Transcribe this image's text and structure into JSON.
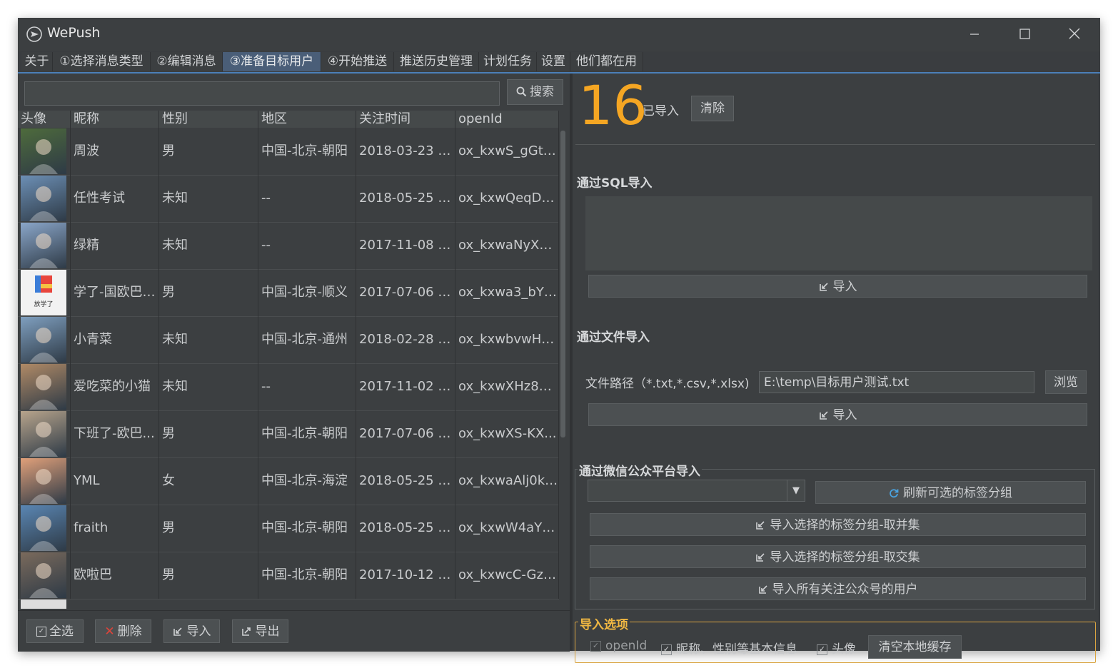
{
  "window": {
    "title": "WePush"
  },
  "tabs": [
    {
      "label": "关于"
    },
    {
      "label": "①选择消息类型"
    },
    {
      "label": "②编辑消息"
    },
    {
      "label": "③准备目标用户"
    },
    {
      "label": "④开始推送"
    },
    {
      "label": "推送历史管理"
    },
    {
      "label": "计划任务"
    },
    {
      "label": "设置"
    },
    {
      "label": "他们都在用"
    }
  ],
  "active_tab": "③准备目标用户",
  "search": {
    "value": "",
    "button_label": "搜索"
  },
  "table": {
    "headers": [
      "头像",
      "昵称",
      "性别",
      "地区",
      "关注时间",
      "openId"
    ],
    "rows": [
      {
        "nickname": "周波",
        "gender": "男",
        "region": "中国-北京-朝阳",
        "time": "2018-03-23 1...",
        "openid": "ox_kxwS_gGt6..."
      },
      {
        "nickname": "任性考试",
        "gender": "未知",
        "region": "--",
        "time": "2018-05-25 1...",
        "openid": "ox_kxwQeqDz..."
      },
      {
        "nickname": "绿精",
        "gender": "未知",
        "region": "--",
        "time": "2017-11-08 1...",
        "openid": "ox_kxwaNyXg..."
      },
      {
        "nickname": "学了-国欧巴-...",
        "gender": "男",
        "region": "中国-北京-顺义",
        "time": "2017-07-06 1...",
        "openid": "ox_kxwa3_bY5..."
      },
      {
        "nickname": "小青菜",
        "gender": "未知",
        "region": "中国-北京-通州",
        "time": "2018-02-28 1...",
        "openid": "ox_kxwbvwHk..."
      },
      {
        "nickname": "爱吃菜的小猫",
        "gender": "未知",
        "region": "--",
        "time": "2017-11-02 1...",
        "openid": "ox_kxwXHz88..."
      },
      {
        "nickname": "下班了-欧巴...",
        "gender": "男",
        "region": "中国-北京-朝阳",
        "time": "2017-07-06 1...",
        "openid": "ox_kxwXS-KX..."
      },
      {
        "nickname": "YML",
        "gender": "女",
        "region": "中国-北京-海淀",
        "time": "2018-05-25 1...",
        "openid": "ox_kxwaAlj0kl..."
      },
      {
        "nickname": "fraith",
        "gender": "男",
        "region": "中国-北京-朝阳",
        "time": "2018-05-25 1...",
        "openid": "ox_kxwW4aYp..."
      },
      {
        "nickname": "欧啦巴",
        "gender": "男",
        "region": "中国-北京-朝阳",
        "time": "2017-10-12 1...",
        "openid": "ox_kxwcC-GzC..."
      }
    ],
    "avatar_colors": [
      "#4e6b3c",
      "#6c8fb5",
      "#8aa6c9",
      "#f2f2f2",
      "#7f9fbf",
      "#b08a66",
      "#b7a48c",
      "#e0a07a",
      "#5a86b3",
      "#7a6a5c"
    ]
  },
  "avatar_caption_row4": "放学了",
  "bottom_buttons": {
    "select_all": "全选",
    "delete": "删除",
    "import": "导入",
    "export": "导出"
  },
  "right": {
    "count": "16",
    "count_label": "已导入",
    "clear_label": "清除",
    "sql_section": {
      "title": "通过SQL导入",
      "button": "导入"
    },
    "file_section": {
      "title": "通过文件导入",
      "path_label": "文件路径（*.txt,*.csv,*.xlsx)",
      "path_value": "E:\\temp\\目标用户测试.txt",
      "browse": "浏览",
      "button": "导入"
    },
    "wechat_section": {
      "title": "通过微信公众平台导入",
      "select_value": "",
      "refresh": "刷新可选的标签分组",
      "union": "导入选择的标签分组-取并集",
      "intersect": "导入选择的标签分组-取交集",
      "all": "导入所有关注公众号的用户"
    },
    "options": {
      "title": "导入选项",
      "openid": "openId",
      "basic_info": "昵称、性别等基本信息",
      "avatar": "头像",
      "clear_cache": "清空本地缓存"
    }
  },
  "colors": {
    "accent": "#f5a623",
    "tab_active": "#4a5e78",
    "delete_icon": "#e0443a",
    "refresh_icon": "#4aa3e0"
  }
}
